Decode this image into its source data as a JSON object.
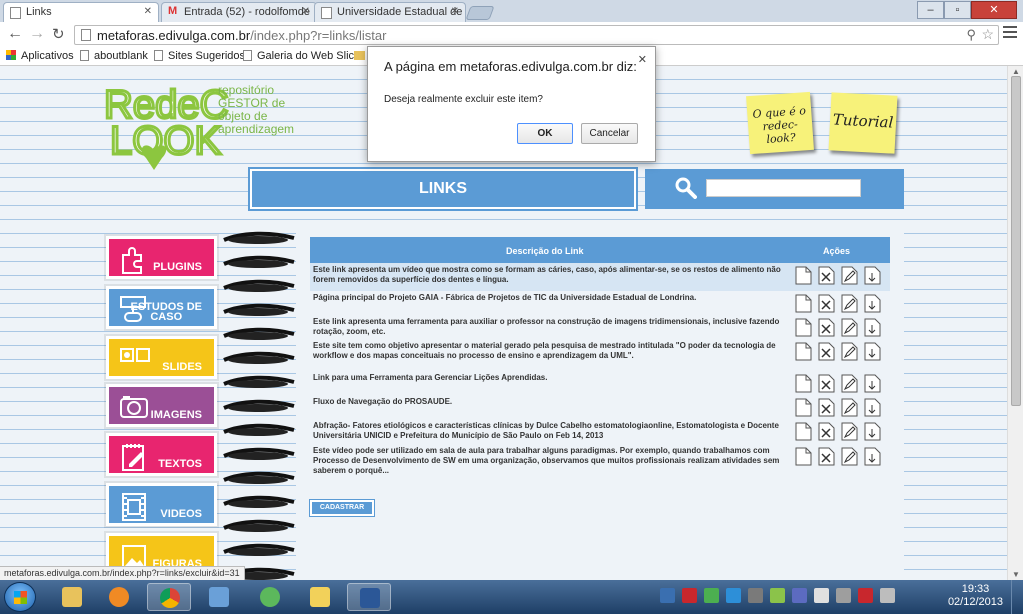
{
  "browser": {
    "tabs": [
      {
        "title": "Links",
        "active": true
      },
      {
        "title": "Entrada (52) - rodolfomde",
        "active": false
      },
      {
        "title": "Universidade Estadual de L",
        "active": false
      }
    ],
    "url_host": "metaforas.edivulga.com.br",
    "url_rest": "/index.php?r=links/listar",
    "bookmarks": [
      "Aplicativos",
      "aboutblank",
      "Sites Sugeridos",
      "Galeria do Web Slice"
    ],
    "status_url": "metaforas.edivulga.com.br/index.php?r=links/excluir&id=31"
  },
  "dialog": {
    "title": "A página em metaforas.edivulga.com.br diz:",
    "message": "Deseja realmente excluir este item?",
    "ok_label": "OK",
    "cancel_label": "Cancelar"
  },
  "site": {
    "logo_text": "RedeC LOOK",
    "tagline": [
      "repositório",
      "GESTOR de",
      "objeto de",
      "aprendizagem"
    ],
    "sticky_notes": [
      "O que é o redec-look?",
      "Tutorial"
    ],
    "section_title": "LINKS",
    "menu": [
      {
        "label": "PLUGINS",
        "color": "#e8256f",
        "icon": "puzzle-icon"
      },
      {
        "label": "ESTUDOS DE CASO",
        "color": "#5b9bd5",
        "icon": "diagram-icon"
      },
      {
        "label": "SLIDES",
        "color": "#f5c518",
        "icon": "slides-icon"
      },
      {
        "label": "IMAGENS",
        "color": "#9b4f96",
        "icon": "camera-icon"
      },
      {
        "label": "TEXTOS",
        "color": "#e8256f",
        "icon": "notepad-icon"
      },
      {
        "label": "VIDEOS",
        "color": "#5b9bd5",
        "icon": "film-icon"
      },
      {
        "label": "FIGURAS",
        "color": "#f5c518",
        "icon": "figure-icon"
      }
    ],
    "table": {
      "headers": [
        "Descrição do Link",
        "Ações"
      ],
      "rows": [
        "Este link apresenta um vídeo que mostra como se formam as cáries, caso, após alimentar-se, se os restos de alimento não forem removidos da superfície dos dentes e língua.",
        "Página principal do Projeto GAIA - Fábrica de Projetos de TIC da Universidade Estadual de Londrina.",
        "Este link apresenta uma ferramenta para auxiliar o professor na construção de imagens tridimensionais, inclusive fazendo rotação, zoom, etc.",
        "Este site tem como objetivo apresentar o material gerado pela pesquisa de mestrado intitulada \"O poder da tecnologia de workflow e dos mapas conceituais no processo de ensino e aprendizagem da UML\".",
        "Link para uma Ferramenta para Gerenciar Lições Aprendidas.",
        "Fluxo de Navegação do PROSAUDE.",
        "Abfração- Fatores etiológicos e características clínicas by Dulce Cabelho estomatologiaonline, Estomatologista e Docente Universitária UNICID e Prefeitura do Município de São Paulo on Feb 14, 2013",
        "Este vídeo pode ser utilizado em sala de aula para trabalhar alguns paradigmas. Por exemplo, quando trabalhamos com Processo de Desenvolvimento de SW em uma organização, observamos que muitos profissionais realizam atividades sem saberem o porquê..."
      ]
    },
    "cadastrar_label": "CADASTRAR"
  },
  "taskbar": {
    "time": "19:33",
    "date": "02/12/2013"
  }
}
